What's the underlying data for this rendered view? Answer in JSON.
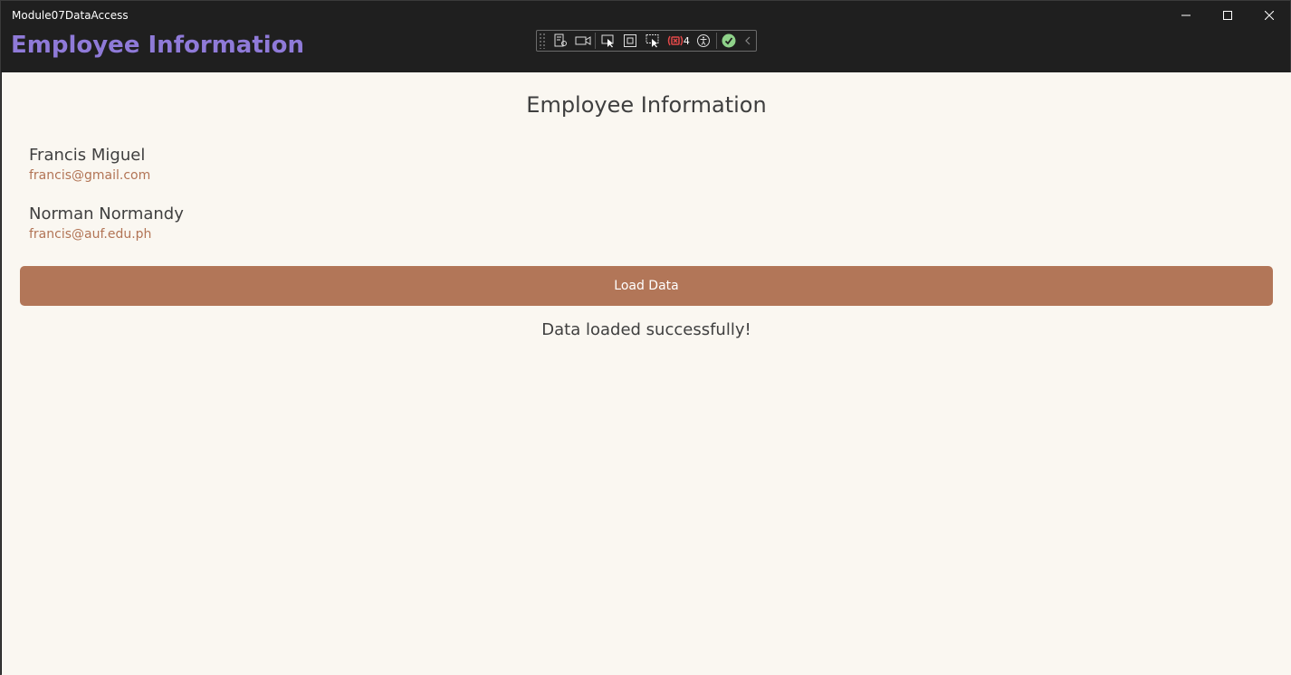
{
  "window": {
    "title": "Module07DataAccess",
    "header": "Employee Information"
  },
  "caption_buttons": {
    "minimize": "minimize-icon",
    "maximize": "maximize-icon",
    "close": "close-icon"
  },
  "debug_toolbar": {
    "icons": [
      "live-visual-tree-icon",
      "video-icon",
      "select-element-icon",
      "display-layout-adorners-icon",
      "track-focus-icon",
      "binding-failures-icon",
      "accessibility-icon",
      "checkmark-icon",
      "collapse-chevron-icon"
    ],
    "binding_failure_count": "4"
  },
  "main": {
    "title": "Employee Information",
    "employees": [
      {
        "name": "Francis Miguel",
        "email": "francis@gmail.com"
      },
      {
        "name": "Norman Normandy",
        "email": "francis@auf.edu.ph"
      }
    ],
    "load_button_label": "Load Data",
    "status": "Data loaded successfully!"
  },
  "colors": {
    "header_accent": "#8f7ad8",
    "button_bg": "#b27658",
    "email_text": "#b27455",
    "content_bg": "#faf7f1"
  }
}
